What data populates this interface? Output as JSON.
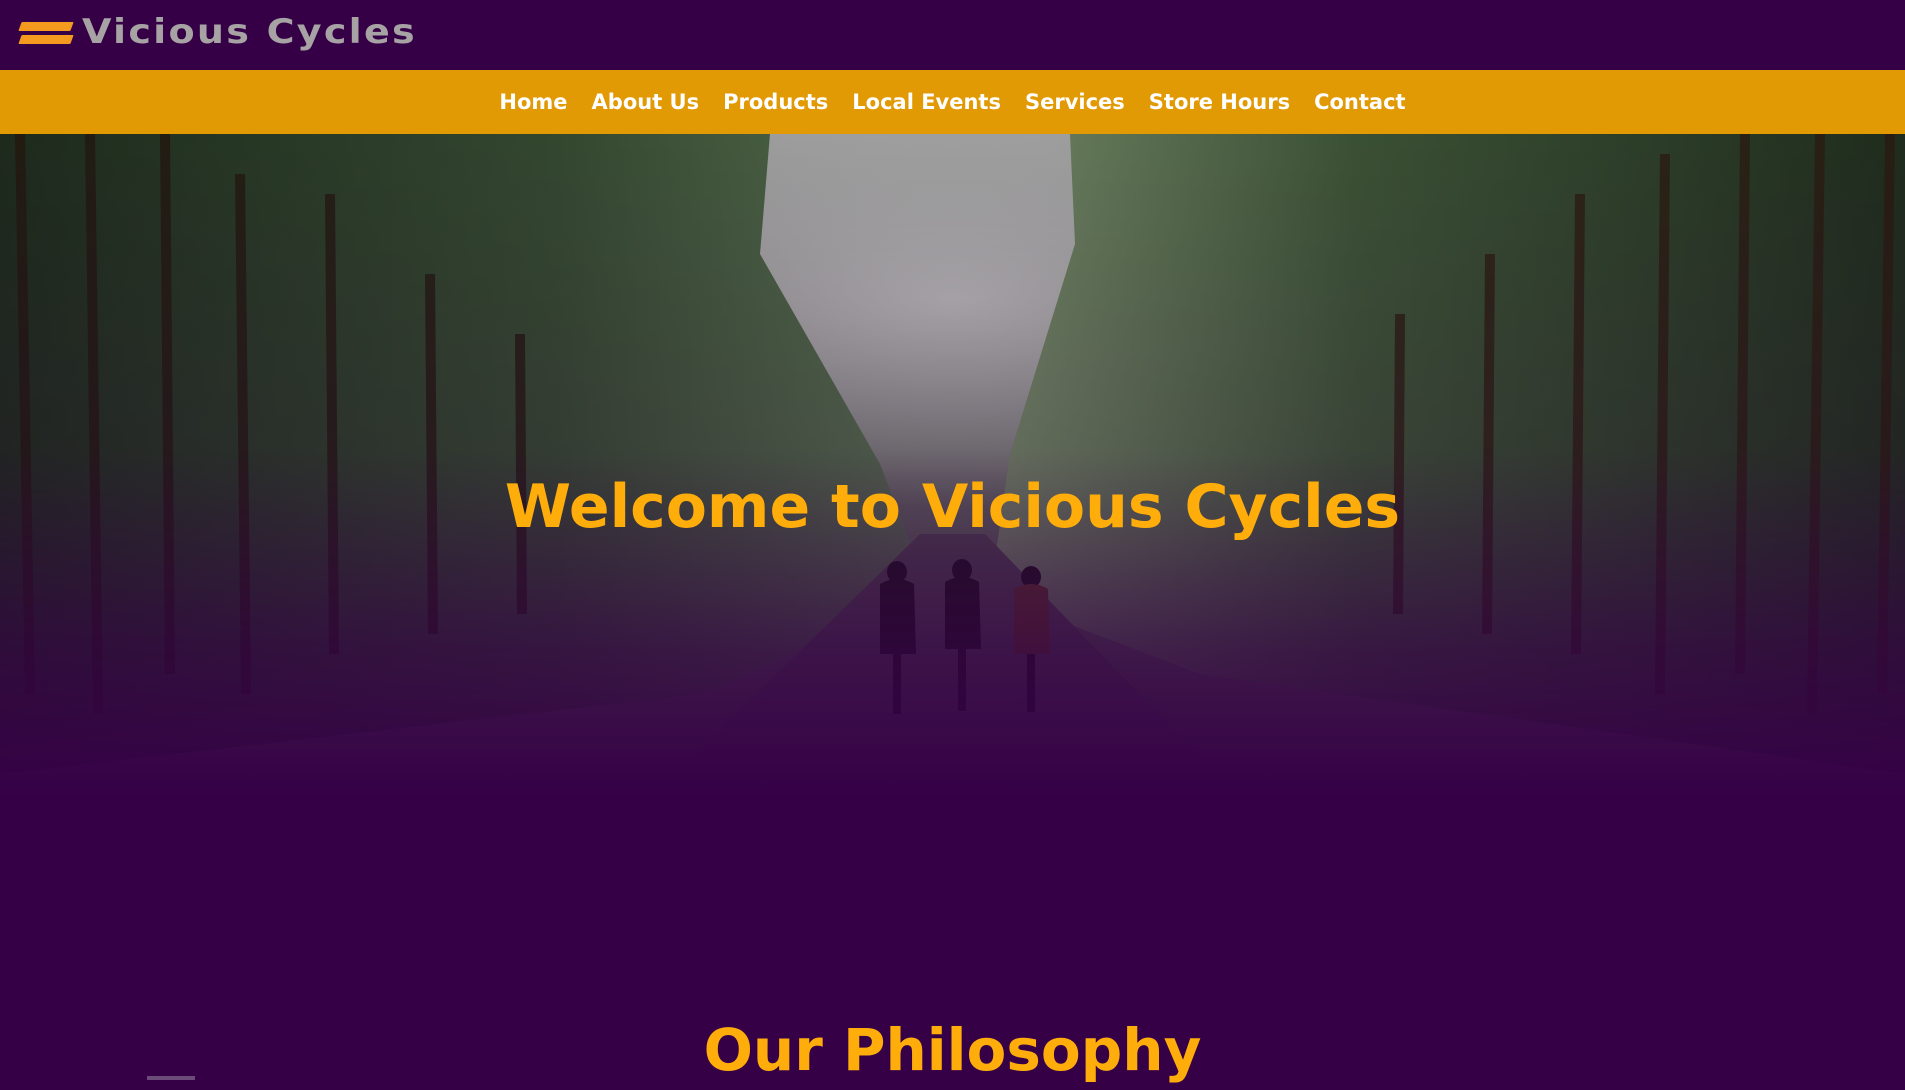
{
  "brand": {
    "name": "Vicious Cycles",
    "accent_color": "#f39a1f",
    "text_color": "#a7a3a5",
    "icon": "speed-lines-logo-icon"
  },
  "nav": {
    "background": "#e19a03",
    "items": [
      {
        "label": "Home"
      },
      {
        "label": "About Us"
      },
      {
        "label": "Products"
      },
      {
        "label": "Local Events"
      },
      {
        "label": "Services"
      },
      {
        "label": "Store Hours"
      },
      {
        "label": "Contact"
      }
    ]
  },
  "hero": {
    "title": "Welcome to Vicious Cycles",
    "image": "forest-road-cyclists-image",
    "title_color": "#ffad0a",
    "fade_color": "#360047"
  },
  "philosophy": {
    "title": "Our Philosophy"
  }
}
